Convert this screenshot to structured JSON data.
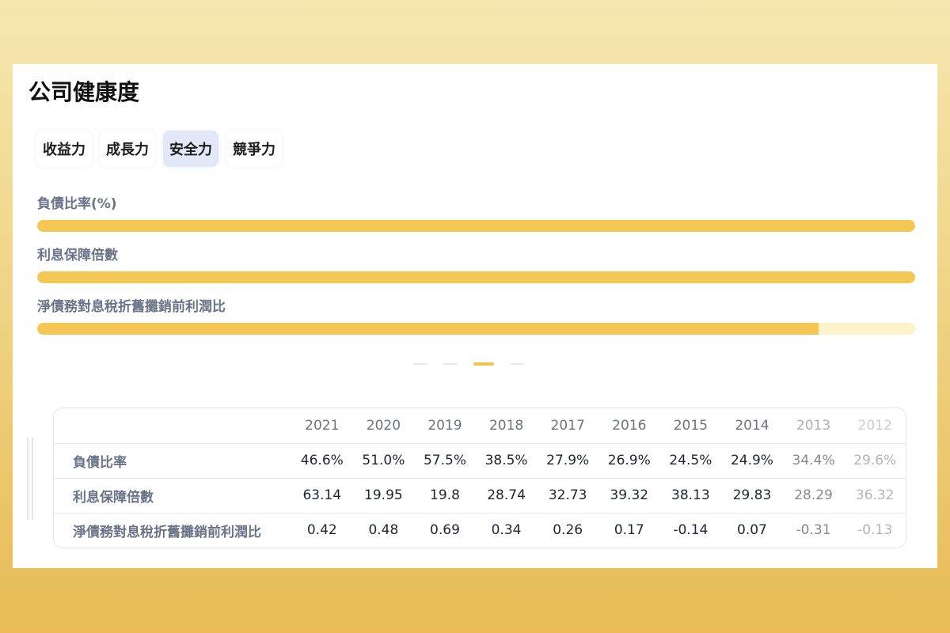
{
  "title": "公司健康度",
  "tabs": [
    {
      "label": "收益力",
      "active": false
    },
    {
      "label": "成長力",
      "active": false
    },
    {
      "label": "安全力",
      "active": true
    },
    {
      "label": "競爭力",
      "active": false
    }
  ],
  "metrics": [
    {
      "label": "負債比率(%)",
      "fill_percent": 100
    },
    {
      "label": "利息保障倍數",
      "fill_percent": 100
    },
    {
      "label": "淨債務對息稅折舊攤銷前利潤比",
      "fill_percent": 89
    }
  ],
  "pager": {
    "count": 4,
    "active_index": 2
  },
  "table": {
    "years": [
      "2021",
      "2020",
      "2019",
      "2018",
      "2017",
      "2016",
      "2015",
      "2014",
      "2013",
      "2012"
    ],
    "rows": [
      {
        "label": "負債比率",
        "values": [
          "46.6%",
          "51.0%",
          "57.5%",
          "38.5%",
          "27.9%",
          "26.9%",
          "24.5%",
          "24.9%",
          "34.4%",
          "29.6%"
        ]
      },
      {
        "label": "利息保障倍數",
        "values": [
          "63.14",
          "19.95",
          "19.8",
          "28.74",
          "32.73",
          "39.32",
          "38.13",
          "29.83",
          "28.29",
          "36.32"
        ]
      },
      {
        "label": "淨債務對息稅折舊攤銷前利潤比",
        "values": [
          "0.42",
          "0.48",
          "0.69",
          "0.34",
          "0.26",
          "0.17",
          "-0.14",
          "0.07",
          "-0.31",
          "-0.13"
        ]
      }
    ]
  },
  "colors": {
    "accent": "#f4c654",
    "track": "#fdf3c9",
    "active_tab": "#e2e8f7",
    "label": "#6a7486"
  }
}
